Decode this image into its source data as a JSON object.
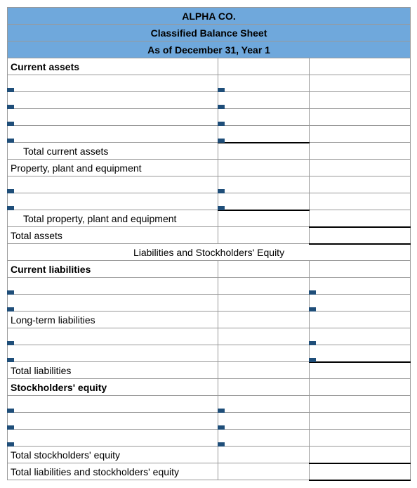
{
  "header": {
    "company": "ALPHA CO.",
    "title": "Classified Balance Sheet",
    "date": "As of December 31, Year 1"
  },
  "labels": {
    "current_assets": "Current assets",
    "total_current_assets": "Total current assets",
    "ppe": "Property, plant and equipment",
    "total_ppe": "Total property, plant and equipment",
    "total_assets": "Total assets",
    "liab_equity_heading": "Liabilities and Stockholders' Equity",
    "current_liabilities": "Current liabilities",
    "long_term_liabilities": "Long-term liabilities",
    "total_liabilities": "Total liabilities",
    "stockholders_equity": "Stockholders' equity",
    "total_stockholders_equity": "Total stockholders' equity",
    "total_liab_equity": "Total liabilities and stockholders' equity"
  }
}
